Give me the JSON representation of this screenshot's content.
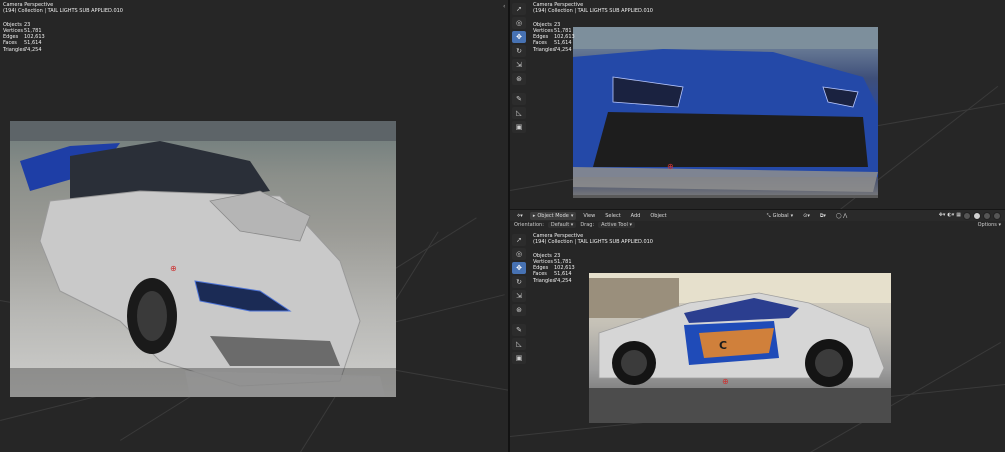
{
  "overlay": {
    "line1": "Camera Perspective",
    "line2": "(194) Collection | TAIL LIGHTS SUB APPLIED.010",
    "stats": [
      {
        "label": "Objects",
        "value": "23"
      },
      {
        "label": "Vertices",
        "value": "51,781"
      },
      {
        "label": "Edges",
        "value": "102,613"
      },
      {
        "label": "Faces",
        "value": "51,614"
      },
      {
        "label": "Triangles",
        "value": "74,254"
      }
    ]
  },
  "header": {
    "mode": "Object Mode",
    "menus": [
      "View",
      "Select",
      "Add",
      "Object"
    ],
    "transform": "Global"
  },
  "subheader": {
    "orientation_label": "Orientation:",
    "orientation_value": "Default",
    "drag_label": "Drag:",
    "drag_value": "Active Tool",
    "options": "Options"
  },
  "icons": {
    "select": "cursor-select-icon",
    "cursor": "3d-cursor-icon",
    "move": "move-icon",
    "rotate": "rotate-icon",
    "scale": "scale-icon",
    "transform": "transform-icon",
    "annotate": "annotate-icon",
    "measure": "measure-icon",
    "add_cube": "add-cube-icon"
  },
  "colors": {
    "viewport_bg": "#262626",
    "active_tool": "#4772b3",
    "header_bg": "#2a2a2a"
  }
}
